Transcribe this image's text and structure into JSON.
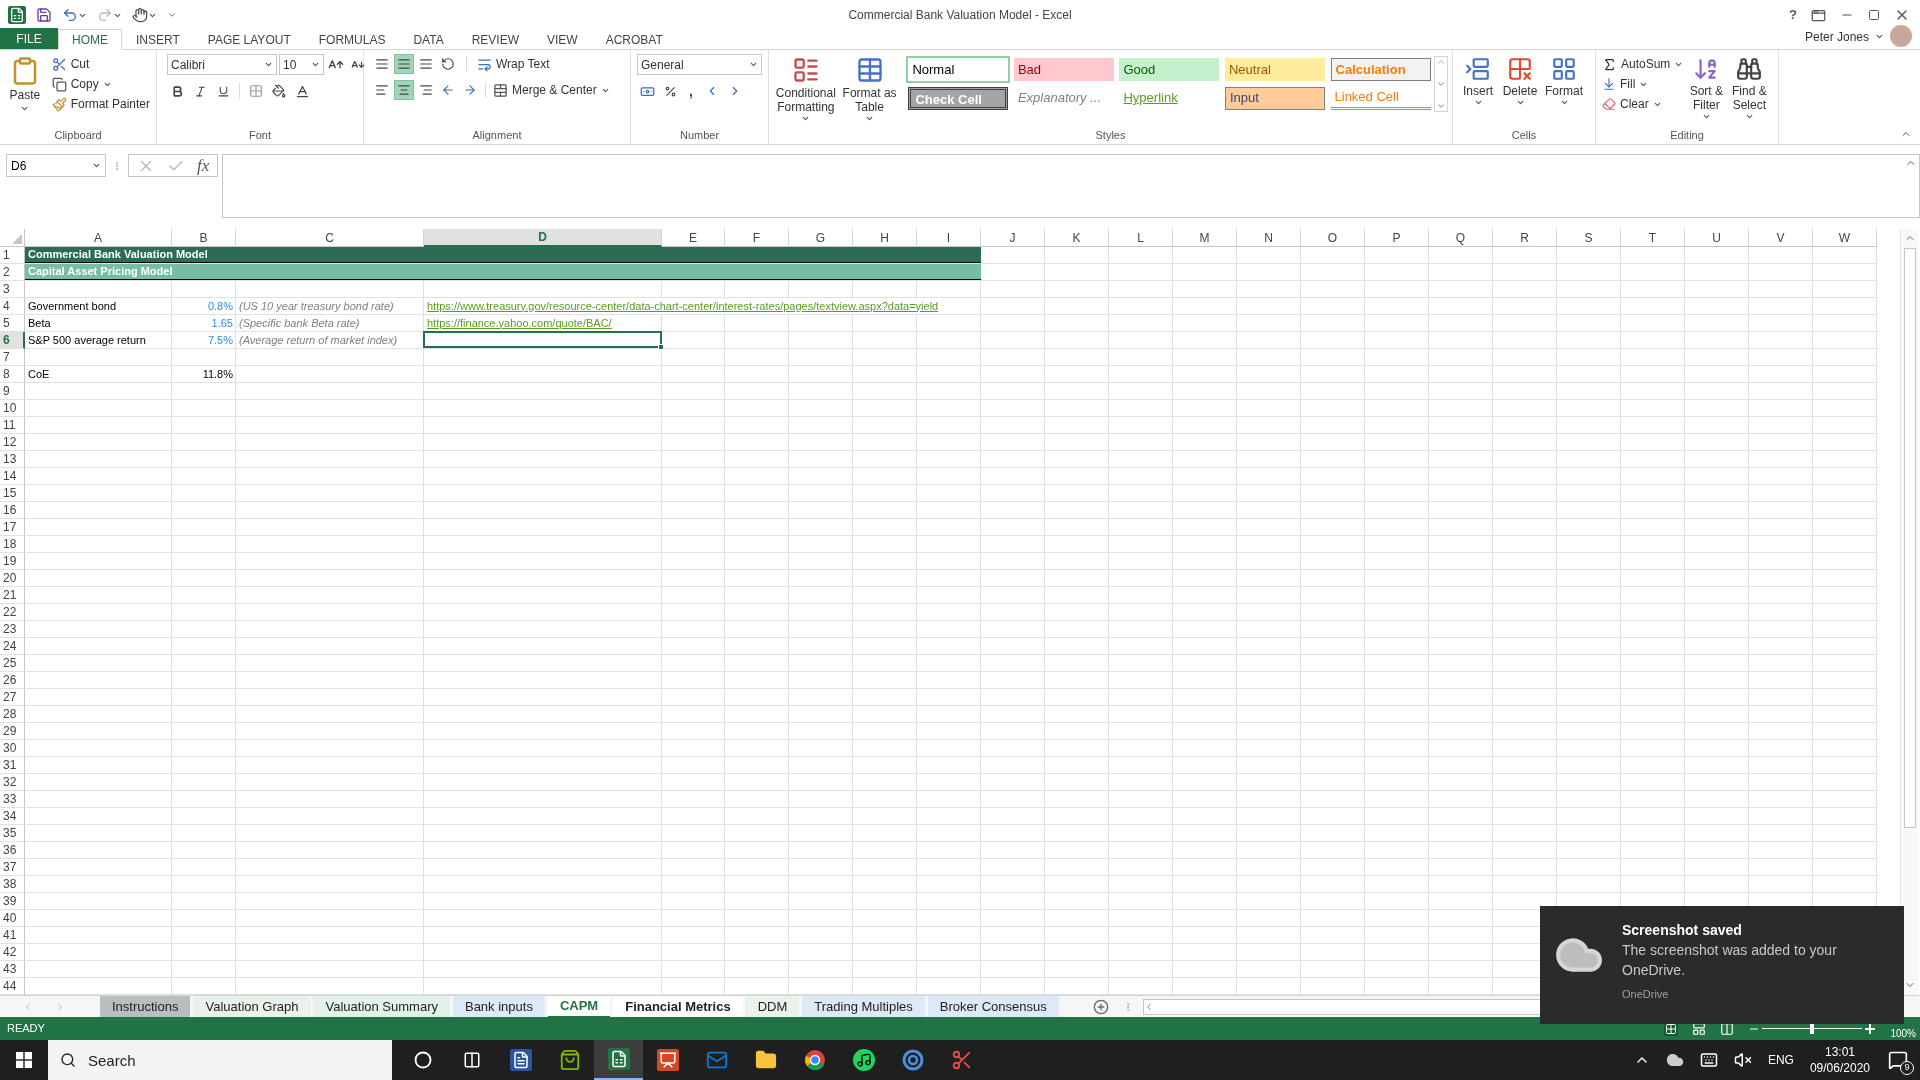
{
  "window": {
    "title": "Commercial Bank Valuation Model - Excel",
    "help": "?",
    "user": "Peter Jones"
  },
  "ribbon": {
    "tabs": [
      {
        "label": "FILE",
        "kind": "file",
        "selected": false
      },
      {
        "label": "HOME",
        "kind": "tab",
        "selected": true
      },
      {
        "label": "INSERT",
        "kind": "tab",
        "selected": false
      },
      {
        "label": "PAGE LAYOUT",
        "kind": "tab",
        "selected": false
      },
      {
        "label": "FORMULAS",
        "kind": "tab",
        "selected": false
      },
      {
        "label": "DATA",
        "kind": "tab",
        "selected": false
      },
      {
        "label": "REVIEW",
        "kind": "tab",
        "selected": false
      },
      {
        "label": "VIEW",
        "kind": "tab",
        "selected": false
      },
      {
        "label": "ACROBAT",
        "kind": "tab",
        "selected": false
      }
    ],
    "clipboard": {
      "label": "Clipboard",
      "paste": "Paste",
      "cut": "Cut",
      "copy": "Copy",
      "format_painter": "Format Painter"
    },
    "font": {
      "label": "Font",
      "name": "Calibri",
      "size": "10"
    },
    "alignment": {
      "label": "Alignment",
      "wrap_text": "Wrap Text",
      "merge_center": "Merge & Center",
      "vertical": [
        {
          "selected": false
        },
        {
          "selected": true
        },
        {
          "selected": false
        }
      ],
      "horizontal": [
        {
          "selected": false
        },
        {
          "selected": true
        },
        {
          "selected": false
        }
      ]
    },
    "number": {
      "label": "Number",
      "format": "General",
      "comma": ","
    },
    "styles": {
      "label": "Styles",
      "conditional_formatting": "Conditional Formatting",
      "format_as_table": "Format as Table",
      "gallery": [
        {
          "label": "Normal",
          "kind": "normal",
          "selected": true
        },
        {
          "label": "Bad",
          "kind": "bad",
          "selected": false
        },
        {
          "label": "Good",
          "kind": "good",
          "selected": false
        },
        {
          "label": "Neutral",
          "kind": "neutral",
          "selected": false
        },
        {
          "label": "Calculation",
          "kind": "calculation",
          "selected": false
        },
        {
          "label": "Check Cell",
          "kind": "check",
          "selected": false
        },
        {
          "label": "Explanatory ...",
          "kind": "explanatory",
          "selected": false
        },
        {
          "label": "Hyperlink",
          "kind": "hyperlink",
          "selected": false
        },
        {
          "label": "Input",
          "kind": "input",
          "selected": false
        },
        {
          "label": "Linked Cell",
          "kind": "linked",
          "selected": false
        }
      ]
    },
    "cells": {
      "label": "Cells",
      "insert": "Insert",
      "delete": "Delete",
      "format": "Format"
    },
    "editing": {
      "label": "Editing",
      "autosum": "AutoSum",
      "fill": "Fill",
      "clear": "Clear",
      "sort_filter": "Sort & Filter",
      "find_select": "Find & Select"
    }
  },
  "formula_bar": {
    "name_box": "D6",
    "function_button": "fx"
  },
  "sheet": {
    "columns": [
      {
        "label": "A",
        "selected": false
      },
      {
        "label": "B",
        "selected": false
      },
      {
        "label": "C",
        "selected": false
      },
      {
        "label": "D",
        "selected": true
      },
      {
        "label": "E",
        "selected": false
      },
      {
        "label": "F",
        "selected": false
      },
      {
        "label": "G",
        "selected": false
      },
      {
        "label": "H",
        "selected": false
      },
      {
        "label": "I",
        "selected": false
      },
      {
        "label": "J",
        "selected": false
      },
      {
        "label": "K",
        "selected": false
      },
      {
        "label": "L",
        "selected": false
      },
      {
        "label": "M",
        "selected": false
      },
      {
        "label": "N",
        "selected": false
      },
      {
        "label": "O",
        "selected": false
      },
      {
        "label": "P",
        "selected": false
      },
      {
        "label": "Q",
        "selected": false
      },
      {
        "label": "R",
        "selected": false
      },
      {
        "label": "S",
        "selected": false
      },
      {
        "label": "T",
        "selected": false
      },
      {
        "label": "U",
        "selected": false
      },
      {
        "label": "V",
        "selected": false
      },
      {
        "label": "W",
        "selected": false
      }
    ],
    "rows": [
      {
        "number": "1",
        "selected": false,
        "cells": {
          "a": {
            "text": "Commercial Bank Valuation Model",
            "kind": "title"
          }
        }
      },
      {
        "number": "2",
        "selected": false,
        "cells": {
          "a": {
            "text": "Capital Asset Pricing Model",
            "kind": "subtitle"
          }
        }
      },
      {
        "number": "3",
        "selected": false
      },
      {
        "number": "4",
        "selected": false,
        "cells": {
          "a": {
            "text": "Government bond",
            "kind": "label"
          },
          "b": {
            "text": "0.8%",
            "kind": "input"
          },
          "c": {
            "text": "(US 10 year treasury bond rate)",
            "kind": "note"
          },
          "d": {
            "text": "https://www.treasury.gov/resource-center/data-chart-center/interest-rates/pages/textview.aspx?data=yield",
            "kind": "link"
          }
        }
      },
      {
        "number": "5",
        "selected": false,
        "cells": {
          "a": {
            "text": "Beta",
            "kind": "label"
          },
          "b": {
            "text": "1.65",
            "kind": "input"
          },
          "c": {
            "text": "(Specific bank Beta rate)",
            "kind": "note"
          },
          "d": {
            "text": "https://finance.yahoo.com/quote/BAC/",
            "kind": "link"
          }
        }
      },
      {
        "number": "6",
        "selected": true,
        "cells": {
          "a": {
            "text": "S&P 500 average return",
            "kind": "label"
          },
          "b": {
            "text": "7.5%",
            "kind": "input"
          },
          "c": {
            "text": "(Average return of market index)",
            "kind": "note"
          }
        }
      },
      {
        "number": "7",
        "selected": false
      },
      {
        "number": "8",
        "selected": false,
        "cells": {
          "a": {
            "text": "CoE",
            "kind": "label"
          },
          "b": {
            "text": "11.8%",
            "kind": "value"
          }
        }
      },
      {
        "number": "9",
        "selected": false
      },
      {
        "number": "10",
        "selected": false
      },
      {
        "number": "11",
        "selected": false
      },
      {
        "number": "12",
        "selected": false
      },
      {
        "number": "13",
        "selected": false
      },
      {
        "number": "14",
        "selected": false
      },
      {
        "number": "15",
        "selected": false
      },
      {
        "number": "16",
        "selected": false
      },
      {
        "number": "17",
        "selected": false
      },
      {
        "number": "18",
        "selected": false
      },
      {
        "number": "19",
        "selected": false
      },
      {
        "number": "20",
        "selected": false
      },
      {
        "number": "21",
        "selected": false
      },
      {
        "number": "22",
        "selected": false
      },
      {
        "number": "23",
        "selected": false
      },
      {
        "number": "24",
        "selected": false
      },
      {
        "number": "25",
        "selected": false
      },
      {
        "number": "26",
        "selected": false
      },
      {
        "number": "27",
        "selected": false
      },
      {
        "number": "28",
        "selected": false
      },
      {
        "number": "29",
        "selected": false
      },
      {
        "number": "30",
        "selected": false
      },
      {
        "number": "31",
        "selected": false
      },
      {
        "number": "32",
        "selected": false
      },
      {
        "number": "33",
        "selected": false
      },
      {
        "number": "34",
        "selected": false
      },
      {
        "number": "35",
        "selected": false
      },
      {
        "number": "36",
        "selected": false
      },
      {
        "number": "37",
        "selected": false
      },
      {
        "number": "38",
        "selected": false
      },
      {
        "number": "39",
        "selected": false
      },
      {
        "number": "40",
        "selected": false
      },
      {
        "number": "41",
        "selected": false
      },
      {
        "number": "42",
        "selected": false
      },
      {
        "number": "43",
        "selected": false
      },
      {
        "number": "44",
        "selected": false
      }
    ]
  },
  "sheet_tabs": [
    {
      "label": "Instructions",
      "color": "#b7bfbf",
      "selected": false,
      "active": false
    },
    {
      "label": "Valuation Graph",
      "color": "#e8f2ea",
      "selected": false,
      "active": false
    },
    {
      "label": "Valuation Summary",
      "color": "#e4f1ea",
      "selected": false,
      "active": false
    },
    {
      "label": "Bank inputs",
      "color": "#dce9f6",
      "selected": false,
      "active": false
    },
    {
      "label": "CAPM",
      "color": "#ffffff",
      "selected": true,
      "active": true
    },
    {
      "label": "Financial Metrics",
      "color": "#ffffff",
      "selected": true,
      "active": false
    },
    {
      "label": "DDM",
      "color": "#eaf2ec",
      "selected": false,
      "active": false
    },
    {
      "label": "Trading Multiples",
      "color": "#dce9f6",
      "selected": false,
      "active": false
    },
    {
      "label": "Broker Consensus",
      "color": "#dce9f6",
      "selected": false,
      "active": false
    }
  ],
  "status_bar": {
    "mode": "READY",
    "zoom_slider": {
      "level": 0.5
    },
    "zoom": "100%"
  },
  "taskbar": {
    "search": {
      "placeholder": "Search"
    },
    "apps": [
      {
        "kind": "cortana",
        "selected": false
      },
      {
        "kind": "taskview",
        "selected": false
      },
      {
        "kind": "word",
        "selected": false
      },
      {
        "kind": "store",
        "selected": false
      },
      {
        "kind": "excel",
        "selected": true
      },
      {
        "kind": "powerpoint",
        "selected": false
      },
      {
        "kind": "mail",
        "selected": false
      },
      {
        "kind": "explorer",
        "selected": false
      },
      {
        "kind": "chrome",
        "selected": false
      },
      {
        "kind": "spotify",
        "selected": false
      },
      {
        "kind": "swirl",
        "selected": false
      },
      {
        "kind": "snip",
        "selected": false
      }
    ],
    "language": "ENG",
    "time": "13:01",
    "date": "09/06/2020",
    "notification_count": "9"
  },
  "notification": {
    "title": "Screenshot saved",
    "message": "The screenshot was added to your OneDrive.",
    "source": "OneDrive"
  }
}
